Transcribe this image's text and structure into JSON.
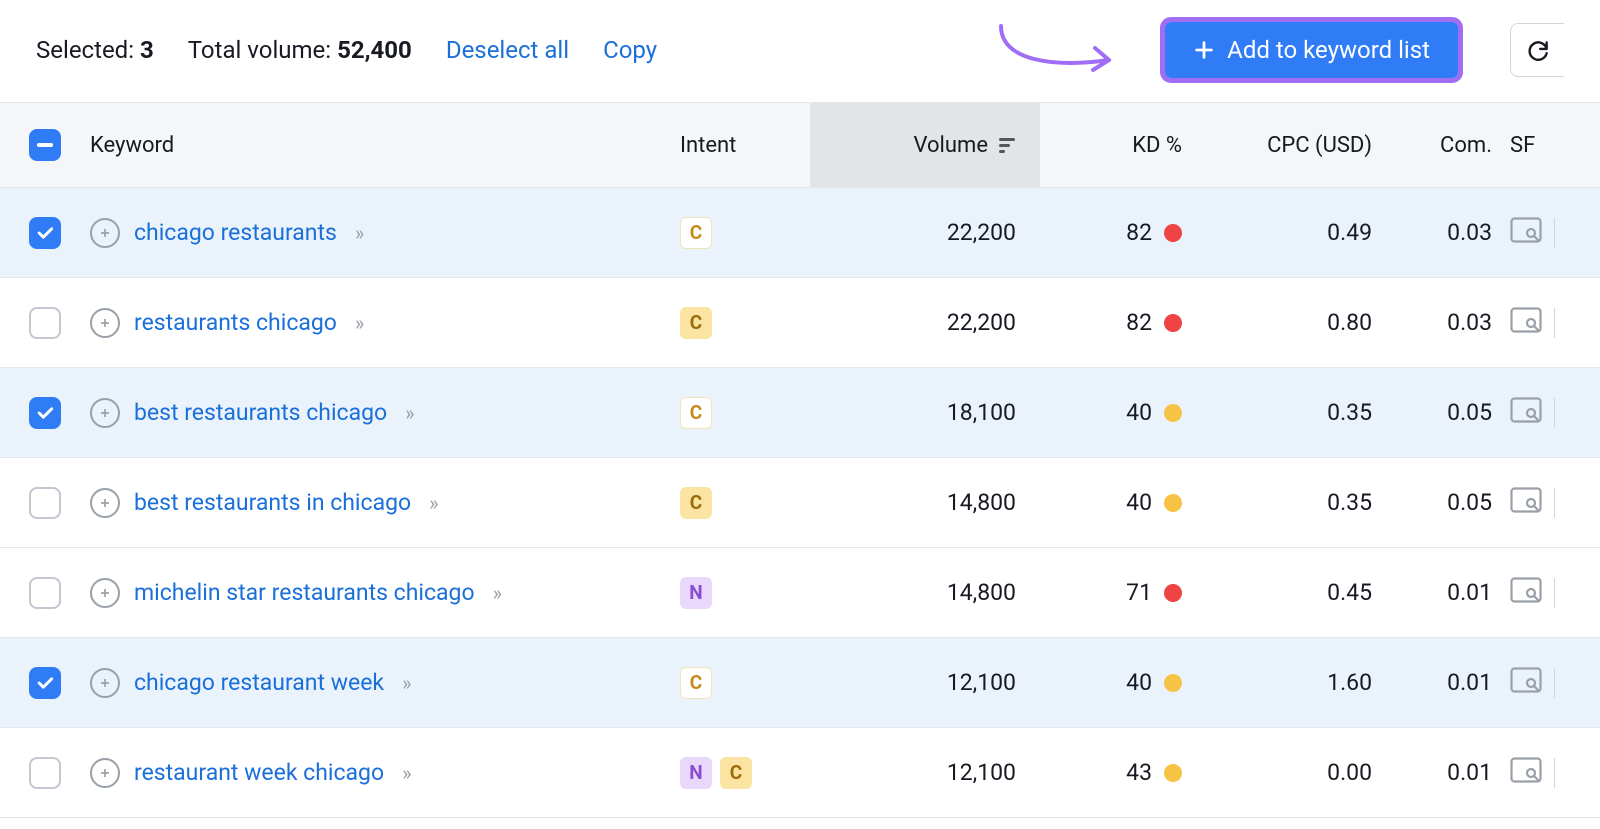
{
  "toolbar": {
    "selected_label": "Selected:",
    "selected_count": "3",
    "total_volume_label": "Total volume:",
    "total_volume_value": "52,400",
    "deselect_label": "Deselect all",
    "copy_label": "Copy",
    "add_button_label": "Add to keyword list"
  },
  "headers": {
    "keyword": "Keyword",
    "intent": "Intent",
    "volume": "Volume",
    "kd": "KD %",
    "cpc": "CPC (USD)",
    "com": "Com.",
    "sf": "SF"
  },
  "rows": [
    {
      "selected": true,
      "keyword": "chicago restaurants",
      "intents": [
        {
          "letter": "C",
          "style": "C-light"
        }
      ],
      "volume": "22,200",
      "kd": "82",
      "kd_color": "red",
      "cpc": "0.49",
      "com": "0.03"
    },
    {
      "selected": false,
      "keyword": "restaurants chicago",
      "intents": [
        {
          "letter": "C",
          "style": "C-solid"
        }
      ],
      "volume": "22,200",
      "kd": "82",
      "kd_color": "red",
      "cpc": "0.80",
      "com": "0.03"
    },
    {
      "selected": true,
      "keyword": "best restaurants chicago",
      "intents": [
        {
          "letter": "C",
          "style": "C-light"
        }
      ],
      "volume": "18,100",
      "kd": "40",
      "kd_color": "yellow",
      "cpc": "0.35",
      "com": "0.05"
    },
    {
      "selected": false,
      "keyword": "best restaurants in chicago",
      "intents": [
        {
          "letter": "C",
          "style": "C-solid"
        }
      ],
      "volume": "14,800",
      "kd": "40",
      "kd_color": "yellow",
      "cpc": "0.35",
      "com": "0.05"
    },
    {
      "selected": false,
      "keyword": "michelin star restaurants chicago",
      "intents": [
        {
          "letter": "N",
          "style": "N"
        }
      ],
      "volume": "14,800",
      "kd": "71",
      "kd_color": "red",
      "cpc": "0.45",
      "com": "0.01"
    },
    {
      "selected": true,
      "keyword": "chicago restaurant week",
      "intents": [
        {
          "letter": "C",
          "style": "C-light"
        }
      ],
      "volume": "12,100",
      "kd": "40",
      "kd_color": "yellow",
      "cpc": "1.60",
      "com": "0.01"
    },
    {
      "selected": false,
      "keyword": "restaurant week chicago",
      "intents": [
        {
          "letter": "N",
          "style": "N"
        },
        {
          "letter": "C",
          "style": "C-solid"
        }
      ],
      "volume": "12,100",
      "kd": "43",
      "kd_color": "yellow",
      "cpc": "0.00",
      "com": "0.01"
    }
  ]
}
